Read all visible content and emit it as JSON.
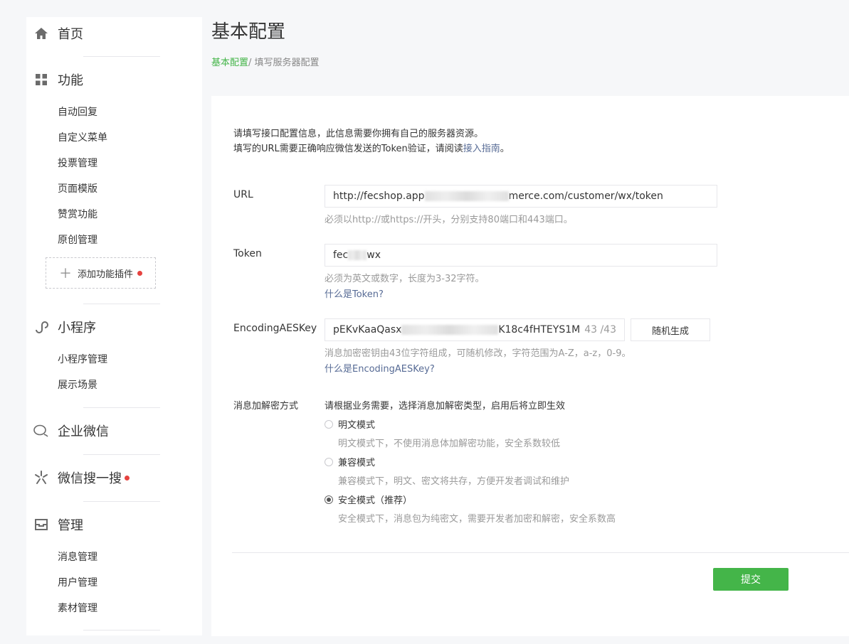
{
  "sidebar": {
    "home": "首页",
    "features": {
      "title": "功能",
      "items": [
        "自动回复",
        "自定义菜单",
        "投票管理",
        "页面模版",
        "赞赏功能",
        "原创管理"
      ],
      "add_plugin": "添加功能插件"
    },
    "miniprogram": {
      "title": "小程序",
      "items": [
        "小程序管理",
        "展示场景"
      ]
    },
    "wework": {
      "title": "企业微信"
    },
    "wxsearch": {
      "title": "微信搜一搜"
    },
    "manage": {
      "title": "管理",
      "items": [
        "消息管理",
        "用户管理",
        "素材管理"
      ]
    }
  },
  "header": {
    "title": "基本配置",
    "breadcrumb_link": "基本配置",
    "breadcrumb_current": "/ 填写服务器配置"
  },
  "form": {
    "intro_line1": "请填写接口配置信息，此信息需要你拥有自己的服务器资源。",
    "intro_line2_prefix": "填写的URL需要正确响应微信发送的Token验证，请阅读",
    "intro_line2_link": "接入指南",
    "intro_line2_suffix": "。",
    "url": {
      "label": "URL",
      "value_prefix": "http://fecshop.app",
      "value_suffix": "merce.com/customer/wx/token",
      "tip": "必须以http://或https://开头，分别支持80端口和443端口。"
    },
    "token": {
      "label": "Token",
      "value_prefix": "fec",
      "value_suffix": "wx",
      "tip": "必须为英文或数字，长度为3-32字符。",
      "help_link": "什么是Token?"
    },
    "aeskey": {
      "label": "EncodingAESKey",
      "value_prefix": "pEKvKaaQasx",
      "value_suffix": "K18c4fHTEYS1M",
      "count": "43 /43",
      "generate_button": "随机生成",
      "tip": "消息加密密钥由43位字符组成，可随机修改，字符范围为A-Z，a-z，0-9。",
      "help_link": "什么是EncodingAESKey?"
    },
    "encrypt": {
      "label": "消息加解密方式",
      "hint": "请根据业务需要，选择消息加解密类型，启用后将立即生效",
      "options": [
        {
          "label": "明文模式",
          "desc": "明文模式下，不使用消息体加解密功能，安全系数较低"
        },
        {
          "label": "兼容模式",
          "desc": "兼容模式下，明文、密文将共存，方便开发者调试和维护"
        },
        {
          "label": "安全模式（推荐）",
          "desc": "安全模式下，消息包为纯密文，需要开发者加密和解密，安全系数高"
        }
      ],
      "selected": "安全模式（推荐）"
    },
    "submit": "提交"
  },
  "colors": {
    "accent": "#44b549",
    "link": "#576b95",
    "badge": "#e64340"
  }
}
